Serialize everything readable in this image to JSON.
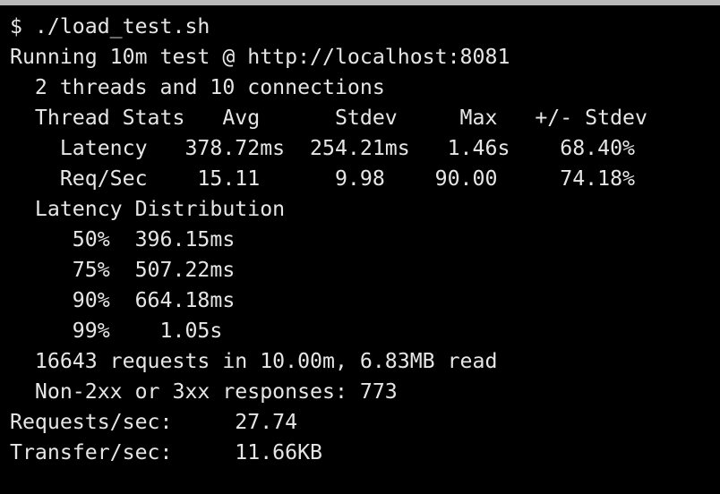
{
  "terminal": {
    "colors": {
      "background": "#000000",
      "text": "#e6e6e6",
      "top_border": "#b9b9b9"
    },
    "lines": [
      "$ ./load_test.sh",
      "Running 10m test @ http://localhost:8081",
      "  2 threads and 10 connections",
      "  Thread Stats   Avg      Stdev     Max   +/- Stdev",
      "    Latency   378.72ms  254.21ms   1.46s    68.40%",
      "    Req/Sec    15.11      9.98    90.00     74.18%",
      "  Latency Distribution",
      "     50%  396.15ms",
      "     75%  507.22ms",
      "     90%  664.18ms",
      "     99%    1.05s",
      "  16643 requests in 10.00m, 6.83MB read",
      "  Non-2xx or 3xx responses: 773",
      "Requests/sec:     27.74",
      "Transfer/sec:     11.66KB"
    ]
  }
}
